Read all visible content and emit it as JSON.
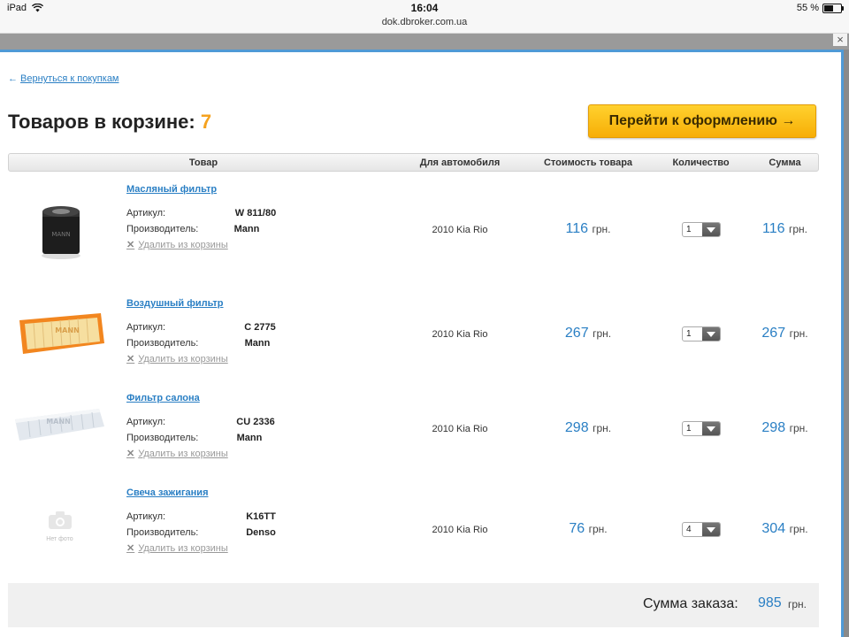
{
  "status_bar": {
    "device": "iPad",
    "time": "16:04",
    "url": "dok.dbroker.com.ua",
    "battery": "55 %",
    "battery_level": 0.55
  },
  "back_link": "Вернуться к покупкам",
  "back_arrow": "←",
  "cart": {
    "title": "Товаров в корзине:",
    "count": "7"
  },
  "checkout_button": "Перейти к оформлению →",
  "close_icon": "×",
  "columns": [
    "Товар",
    "Для автомобиля",
    "Стоимость товара",
    "Количество",
    "Сумма"
  ],
  "labels": {
    "article": "Артикул:",
    "manufacturer": "Производитель:",
    "remove": "Удалить из корзины",
    "currency": "грн.",
    "no_photo": "Нет фото"
  },
  "items": [
    {
      "name": "Масляный фильтр",
      "article": "W 811/80",
      "manufacturer": "Mann",
      "car": "2010 Kia Rio",
      "price": "116",
      "qty": "1",
      "sum": "116"
    },
    {
      "name": "Воздушный фильтр",
      "article": "C 2775",
      "manufacturer": "Mann",
      "car": "2010 Kia Rio",
      "price": "267",
      "qty": "1",
      "sum": "267"
    },
    {
      "name": "Фильтр салона",
      "article": "CU 2336",
      "manufacturer": "Mann",
      "car": "2010 Kia Rio",
      "price": "298",
      "qty": "1",
      "sum": "298"
    },
    {
      "name": "Свеча зажигания",
      "article": "K16TT",
      "manufacturer": "Denso",
      "car": "2010 Kia Rio",
      "price": "76",
      "qty": "4",
      "sum": "304"
    }
  ],
  "total": {
    "label": "Сумма заказа:",
    "value": "985",
    "currency": "грн."
  },
  "colors": {
    "accent": "#2a7fc4",
    "button": "#f7ae06",
    "count": "#f5a21e",
    "modal_border": "#4f9ad6"
  }
}
